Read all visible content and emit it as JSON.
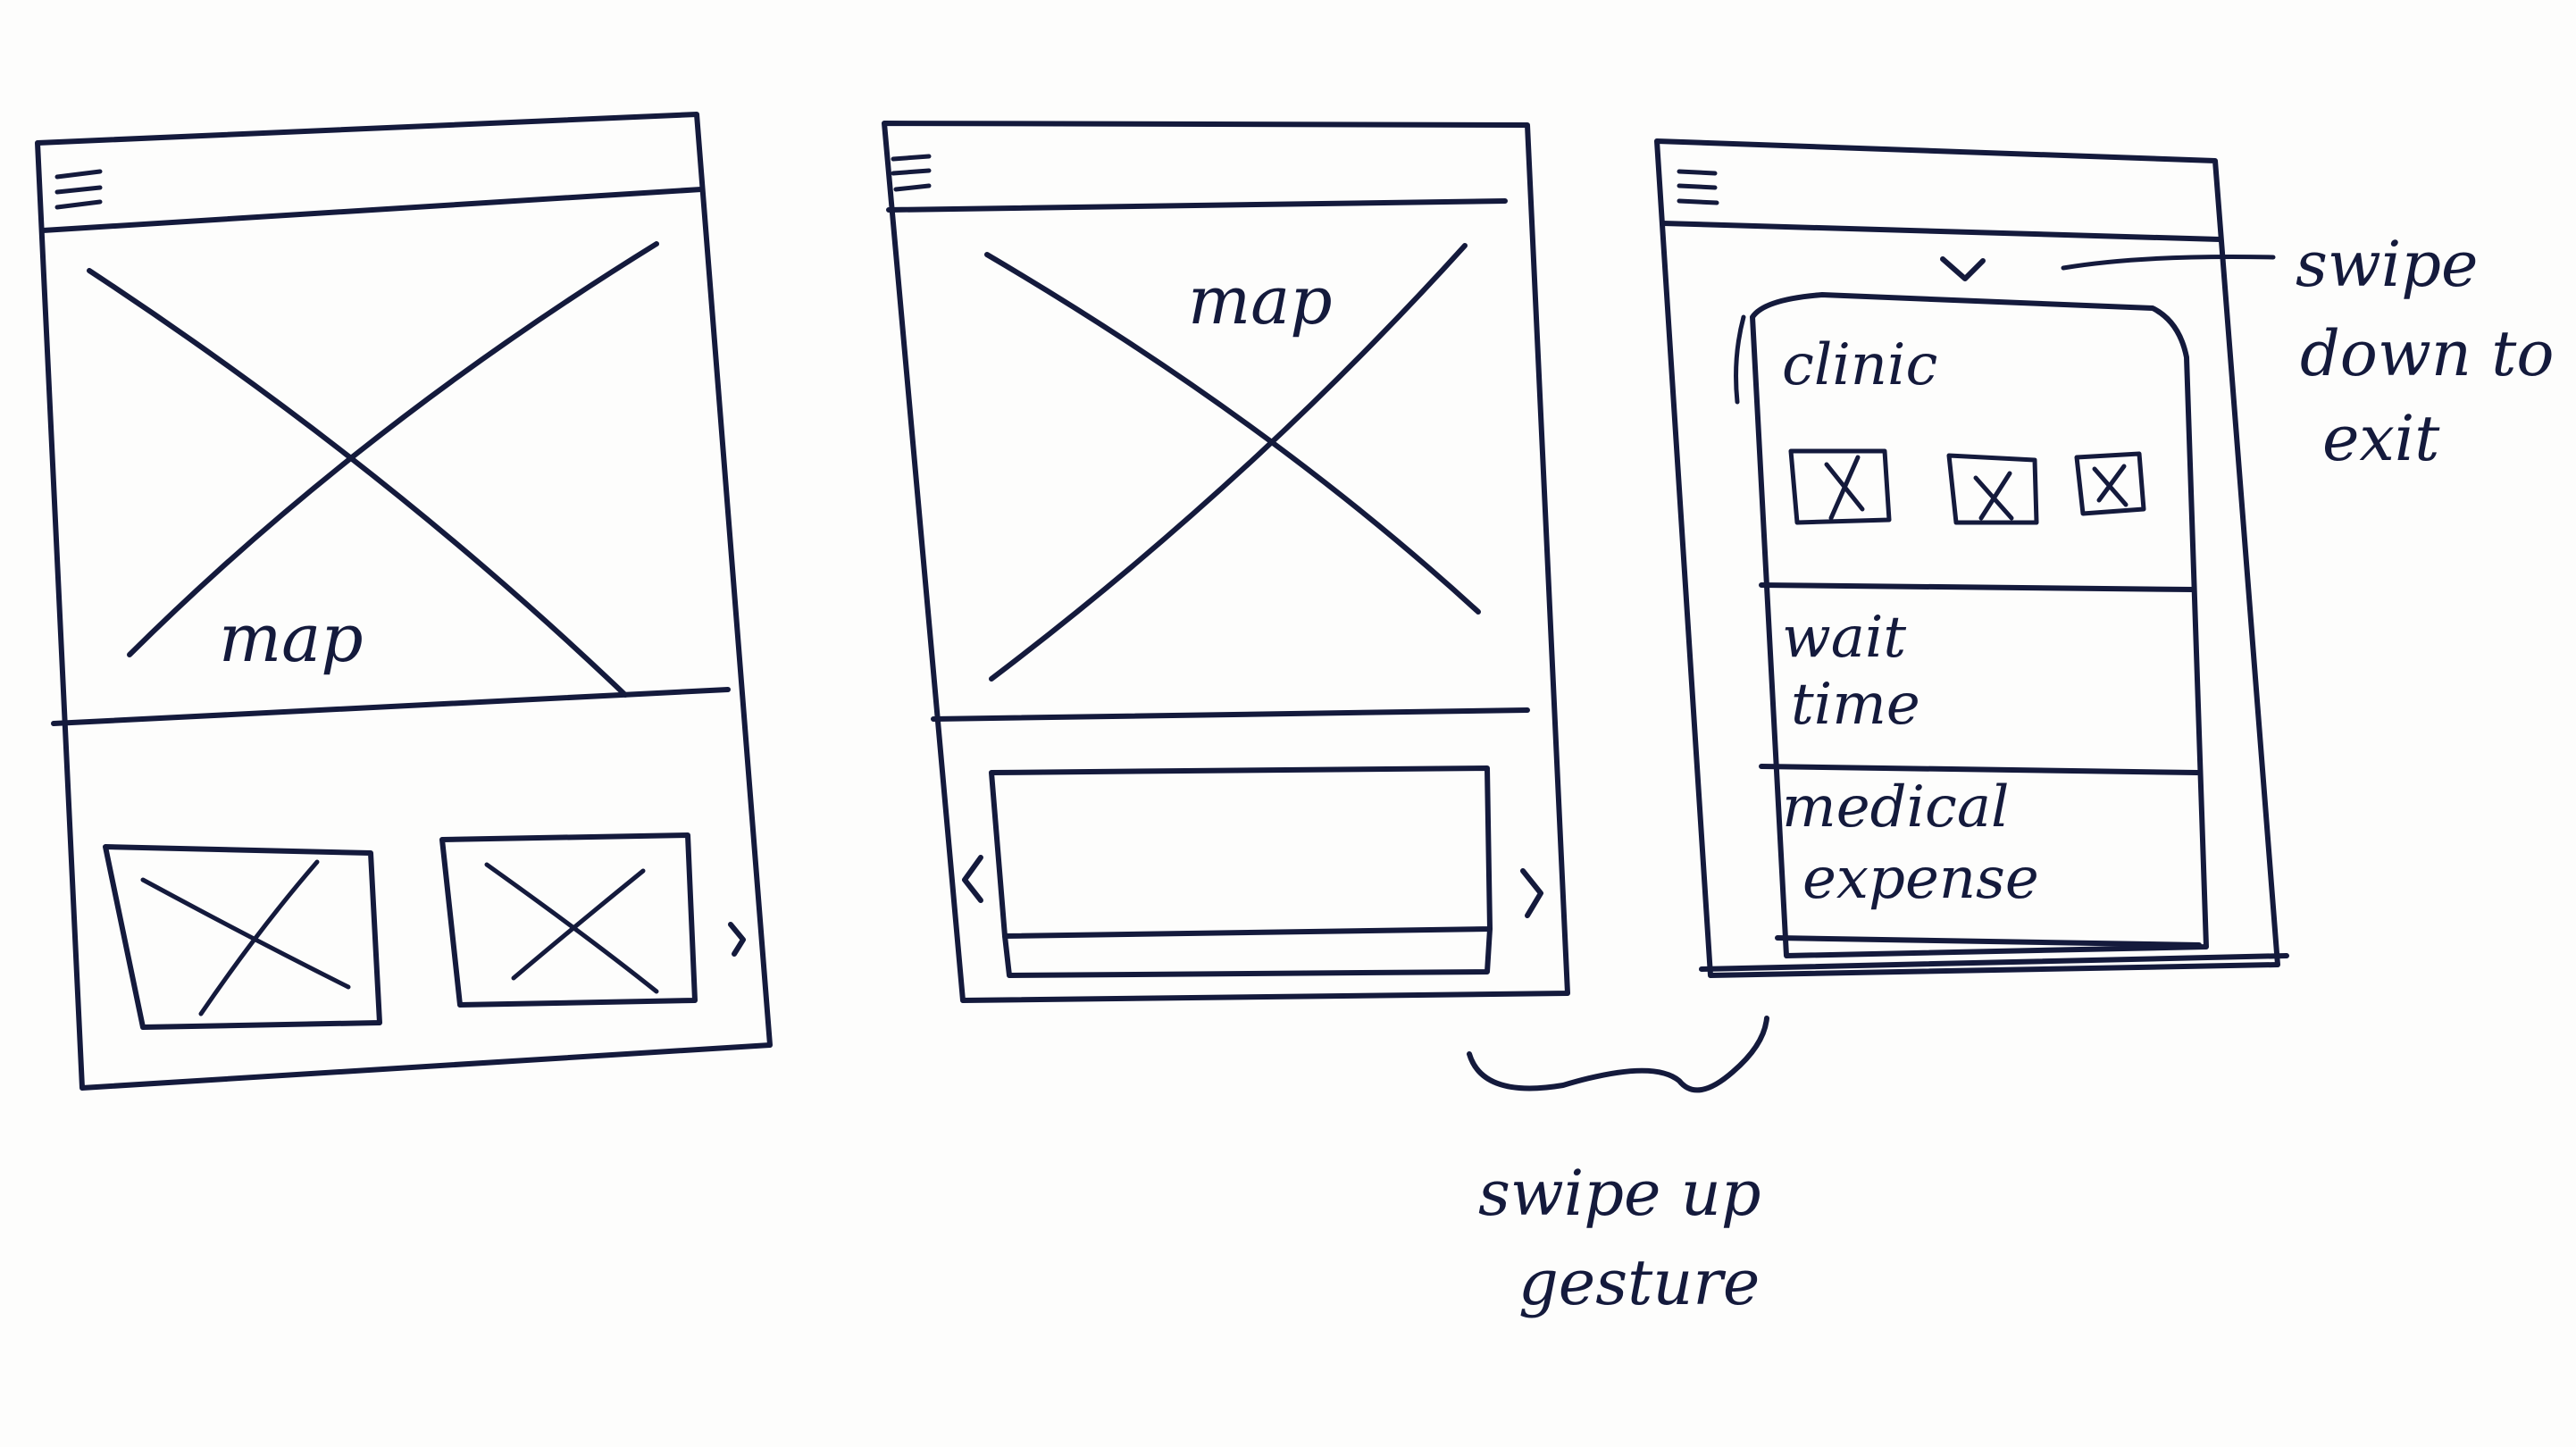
{
  "wireframe_1": {
    "map_label": "map",
    "menu_icon": "hamburger-menu-icon",
    "card_icons": [
      "image-placeholder-icon",
      "image-placeholder-icon"
    ],
    "next_icon": "chevron-right-icon"
  },
  "wireframe_2": {
    "map_label": "map",
    "menu_icon": "hamburger-menu-icon",
    "prev_icon": "chevron-left-icon",
    "next_icon": "chevron-right-icon"
  },
  "wireframe_3": {
    "menu_icon": "hamburger-menu-icon",
    "collapse_icon": "chevron-down-icon",
    "clinic_label": "clinic",
    "wait_time_line1": "wait",
    "wait_time_line2": "time",
    "medical_expense_line1": "medical",
    "medical_expense_line2": "expense"
  },
  "annotations": {
    "swipe_down_line1": "swipe",
    "swipe_down_line2": "down to",
    "swipe_down_line3": "exit",
    "swipe_up_line1": "swipe up",
    "swipe_up_line2": "gesture"
  },
  "colors": {
    "ink": "#141a3c",
    "paper": "#fdfdfc"
  }
}
